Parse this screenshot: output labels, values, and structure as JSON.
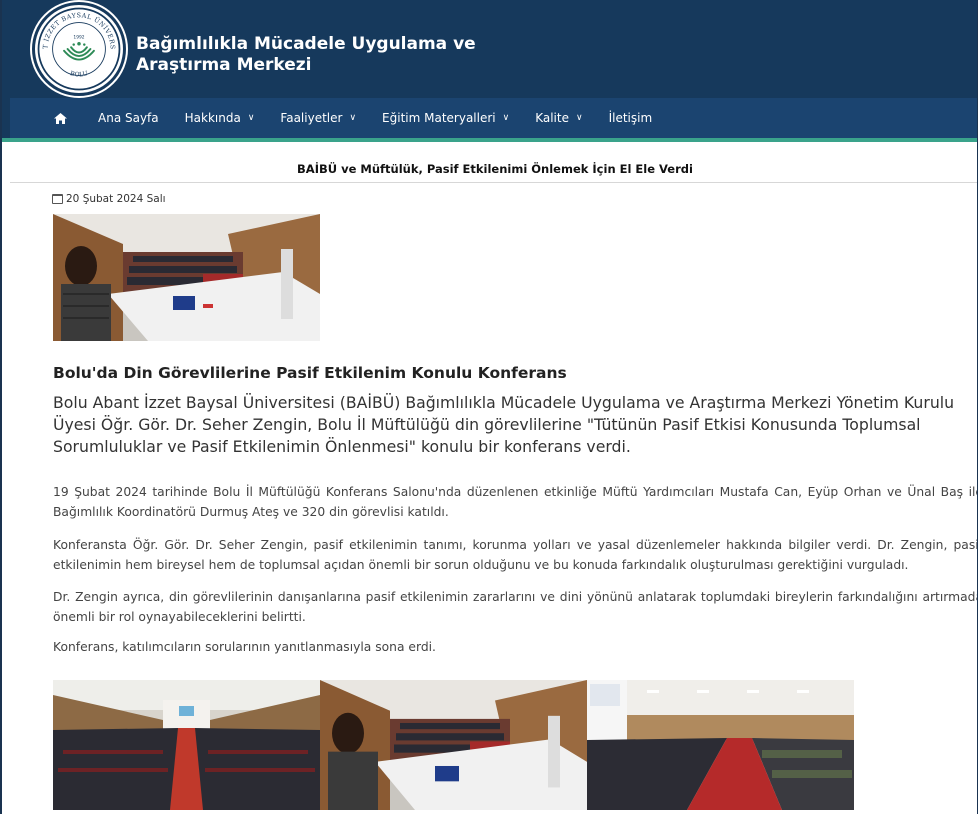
{
  "header": {
    "title_line1": "Bağımlılıkla Mücadele Uygulama ve",
    "title_line2": "Araştırma Merkezi",
    "logo": {
      "arc_text": "ABANT İZZET BAYSAL ÜNİVERSİTESİ",
      "bottom_text": "BOLU",
      "year": "1992"
    }
  },
  "nav": {
    "home_icon": "home-icon",
    "items": [
      {
        "label": "Ana Sayfa",
        "dropdown": false
      },
      {
        "label": "Hakkında",
        "dropdown": true
      },
      {
        "label": "Faaliyetler",
        "dropdown": true
      },
      {
        "label": "Eğitim Materyalleri",
        "dropdown": true
      },
      {
        "label": "Kalite",
        "dropdown": true
      },
      {
        "label": "İletişim",
        "dropdown": false
      }
    ]
  },
  "article": {
    "title": "BAİBÜ ve Müftülük, Pasif Etkilenimi Önlemek İçin El Ele Verdi",
    "date": "20 Şubat 2024 Salı",
    "subheading": "Bolu'da Din Görevlilerine Pasif Etkilenim Konulu Konferans",
    "lead": "Bolu Abant İzzet Baysal Üniversitesi (BAİBÜ) Bağımlılıkla Mücadele Uygulama ve Araştırma Merkezi Yönetim Kurulu Üyesi Öğr. Gör. Dr. Seher Zengin, Bolu İl Müftülüğü din görevlilerine \"Tütünün Pasif Etkisi Konusunda Toplumsal Sorumluluklar ve Pasif Etkilenimin Önlenmesi\" konulu bir konferans verdi.",
    "paragraphs": [
      "19 Şubat 2024 tarihinde Bolu İl Müftülüğü Konferans Salonu'nda düzenlenen etkinliğe Müftü Yardımcıları Mustafa Can, Eyüp Orhan ve Ünal Baş ile Bağımlılık Koordinatörü Durmuş Ateş ve 320 din görevlisi katıldı.",
      "Konferansta Öğr. Gör. Dr. Seher Zengin, pasif etkilenimin tanımı, korunma yolları ve yasal düzenlemeler hakkında bilgiler verdi. Dr. Zengin, pasif etkilenimin hem bireysel hem de toplumsal açıdan önemli bir sorun olduğunu ve bu konuda farkındalık oluşturulması gerektiğini vurguladı.",
      "Dr. Zengin ayrıca, din görevlilerinin danışanlarına pasif etkilenimin zararlarını ve dini yönünü anlatarak toplumdaki bireylerin farkındalığını artırmada önemli bir rol oynayabileceklerini belirtti.",
      "Konferans, katılımcıların sorularının yanıtlanmasıyla sona erdi."
    ]
  },
  "colors": {
    "header_bg": "#16395c",
    "nav_bg": "#1b4470",
    "accent": "#3aa38b"
  }
}
